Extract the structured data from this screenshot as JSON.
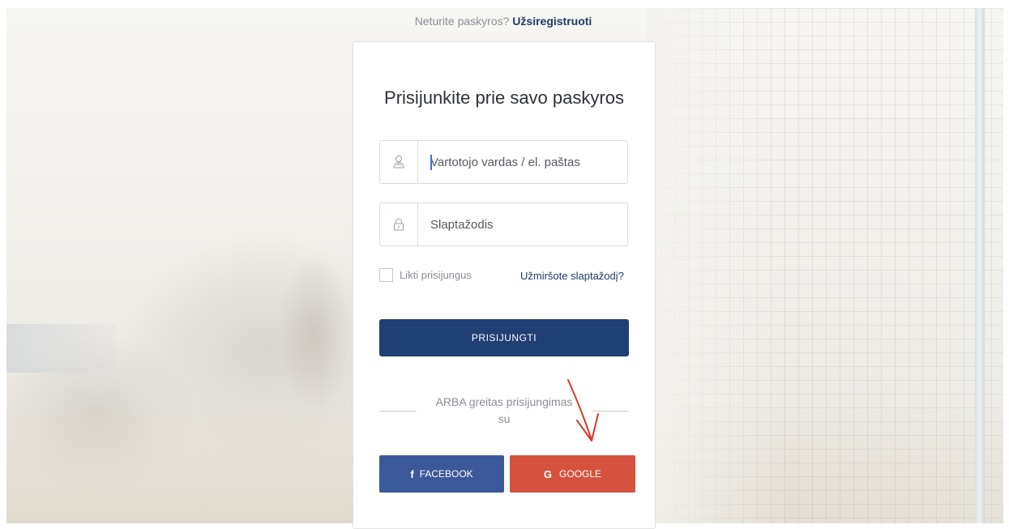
{
  "header": {
    "prompt": "Neturite paskyros?",
    "register_link": "Užsiregistruoti"
  },
  "login_card": {
    "title": "Prisijunkite prie savo paskyros",
    "username": {
      "placeholder": "Vartotojo vardas / el. paštas",
      "icon": "user-icon"
    },
    "password": {
      "placeholder": "Slaptažodis",
      "icon": "lock-icon"
    },
    "remember_label": "Likti prisijungus",
    "forgot_link": "Užmiršote slaptažodį?",
    "submit_label": "PRISIJUNGTI",
    "divider_text": "ARBA greitas prisijungimas su",
    "social": {
      "facebook": {
        "icon": "f",
        "label": "FACEBOOK"
      },
      "google": {
        "icon": "G",
        "label": "GOOGLE"
      }
    }
  },
  "colors": {
    "primary": "#1f3f75",
    "facebook": "#3b5898",
    "google": "#d5533e",
    "link": "#1f3b6b",
    "annotation_arrow": "#d9382a"
  }
}
